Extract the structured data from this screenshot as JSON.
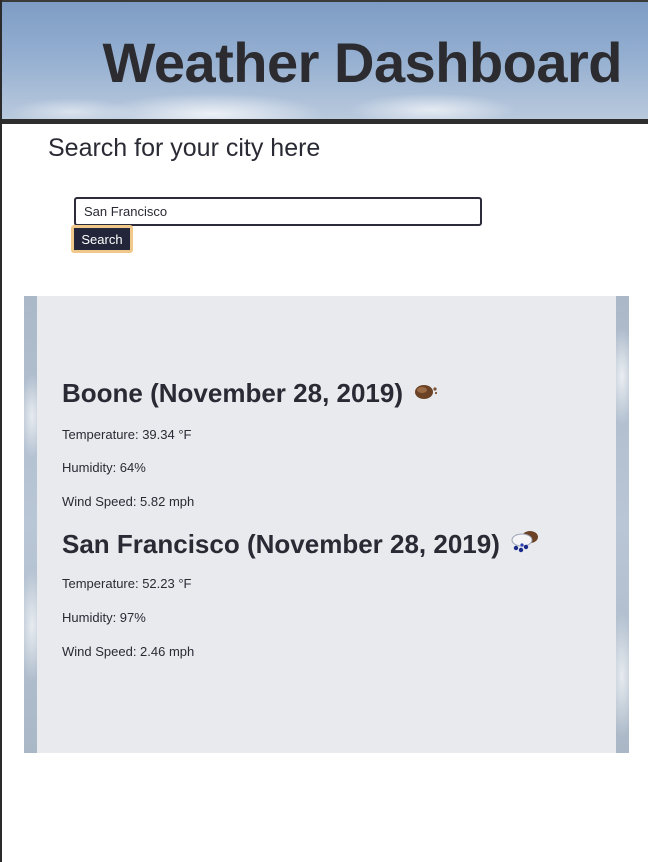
{
  "header": {
    "title": "Weather Dashboard"
  },
  "search": {
    "heading": "Search for your city here",
    "input_value": "San Francisco",
    "button_label": "Search"
  },
  "results": [
    {
      "title": "Boone (November 28, 2019)",
      "icon": "cloudy-icon",
      "temperature": "Temperature: 39.34 °F",
      "humidity": "Humidity: 64%",
      "wind": "Wind Speed: 5.82 mph"
    },
    {
      "title": "San Francisco (November 28, 2019)",
      "icon": "rain-cloud-icon",
      "temperature": "Temperature: 52.23 °F",
      "humidity": "Humidity: 97%",
      "wind": "Wind Speed: 2.46 mph"
    }
  ],
  "colors": {
    "header_text": "#2b2b30",
    "button_bg": "#23263a",
    "button_focus_ring": "#f0c88a",
    "panel_bg": "#e9eaee"
  }
}
